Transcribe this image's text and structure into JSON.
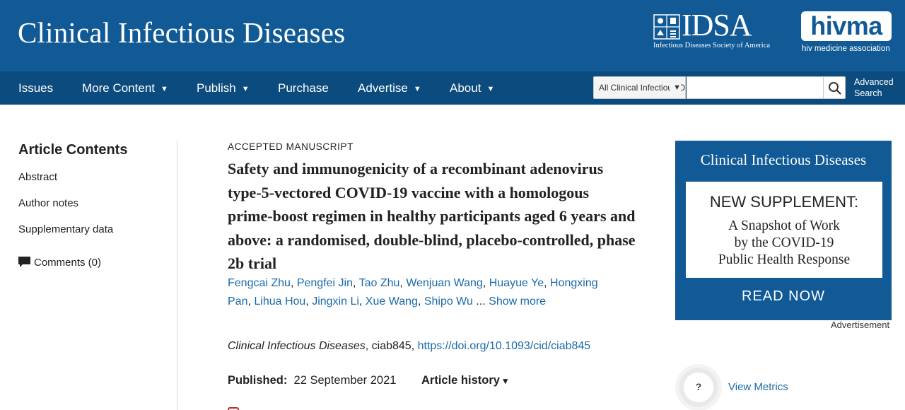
{
  "header": {
    "journal_title": "Clinical Infectious Diseases",
    "idsa_logo_text": "IDSA",
    "idsa_logo_subtitle": "Infectious Diseases Society of America",
    "hivma_logo_text": "hivma",
    "hivma_logo_subtitle": "hiv medicine association",
    "brand_color": "#115a96",
    "nav_color": "#0c4b7e"
  },
  "nav": {
    "items": [
      {
        "label": "Issues",
        "has_dropdown": false
      },
      {
        "label": "More Content",
        "has_dropdown": true
      },
      {
        "label": "Publish",
        "has_dropdown": true
      },
      {
        "label": "Purchase",
        "has_dropdown": false
      },
      {
        "label": "Advertise",
        "has_dropdown": true
      },
      {
        "label": "About",
        "has_dropdown": true
      }
    ],
    "dropdown_caret": "▼"
  },
  "search": {
    "scope_selected": "All Clinical Infectious Diseases",
    "input_value": "",
    "button_icon": "search-icon",
    "advanced_line1": "Advanced",
    "advanced_line2": "Search"
  },
  "sidebar": {
    "heading": "Article Contents",
    "links": [
      "Abstract",
      "Author notes",
      "Supplementary data"
    ],
    "comments_label": "Comments (0)",
    "comments_icon": "speech-bubble-icon"
  },
  "article": {
    "kicker": "ACCEPTED MANUSCRIPT",
    "title": "Safety and immunogenicity of a recombinant adenovirus type-5-vectored COVID-19 vaccine with a homologous prime-boost regimen in healthy participants aged 6 years and above: a randomised, double-blind, placebo-controlled, phase 2b trial",
    "authors": [
      "Fengcai Zhu",
      "Pengfei Jin",
      "Tao Zhu",
      "Wenjuan Wang",
      "Huayue Ye",
      "Hongxing Pan",
      "Lihua Hou",
      "Jingxin Li",
      "Xue Wang",
      "Shipo Wu"
    ],
    "authors_ellipsis": "...",
    "show_more": "Show more",
    "journal_name": "Clinical Infectious Diseases",
    "article_id": ", ciab845, ",
    "doi": "https://doi.org/10.1093/cid/ciab845",
    "published_label": "Published:",
    "published_date": "22 September 2021",
    "history_label": "Article history",
    "history_caret": "▾"
  },
  "ad": {
    "title": "Clinical Infectious Diseases",
    "headline": "NEW SUPPLEMENT:",
    "body_lines": [
      "A Snapshot of Work",
      "by the COVID-19",
      "Public Health Response"
    ],
    "cta": "READ NOW",
    "label": "Advertisement"
  },
  "metrics": {
    "badge_text": "?",
    "link": "View Metrics"
  }
}
